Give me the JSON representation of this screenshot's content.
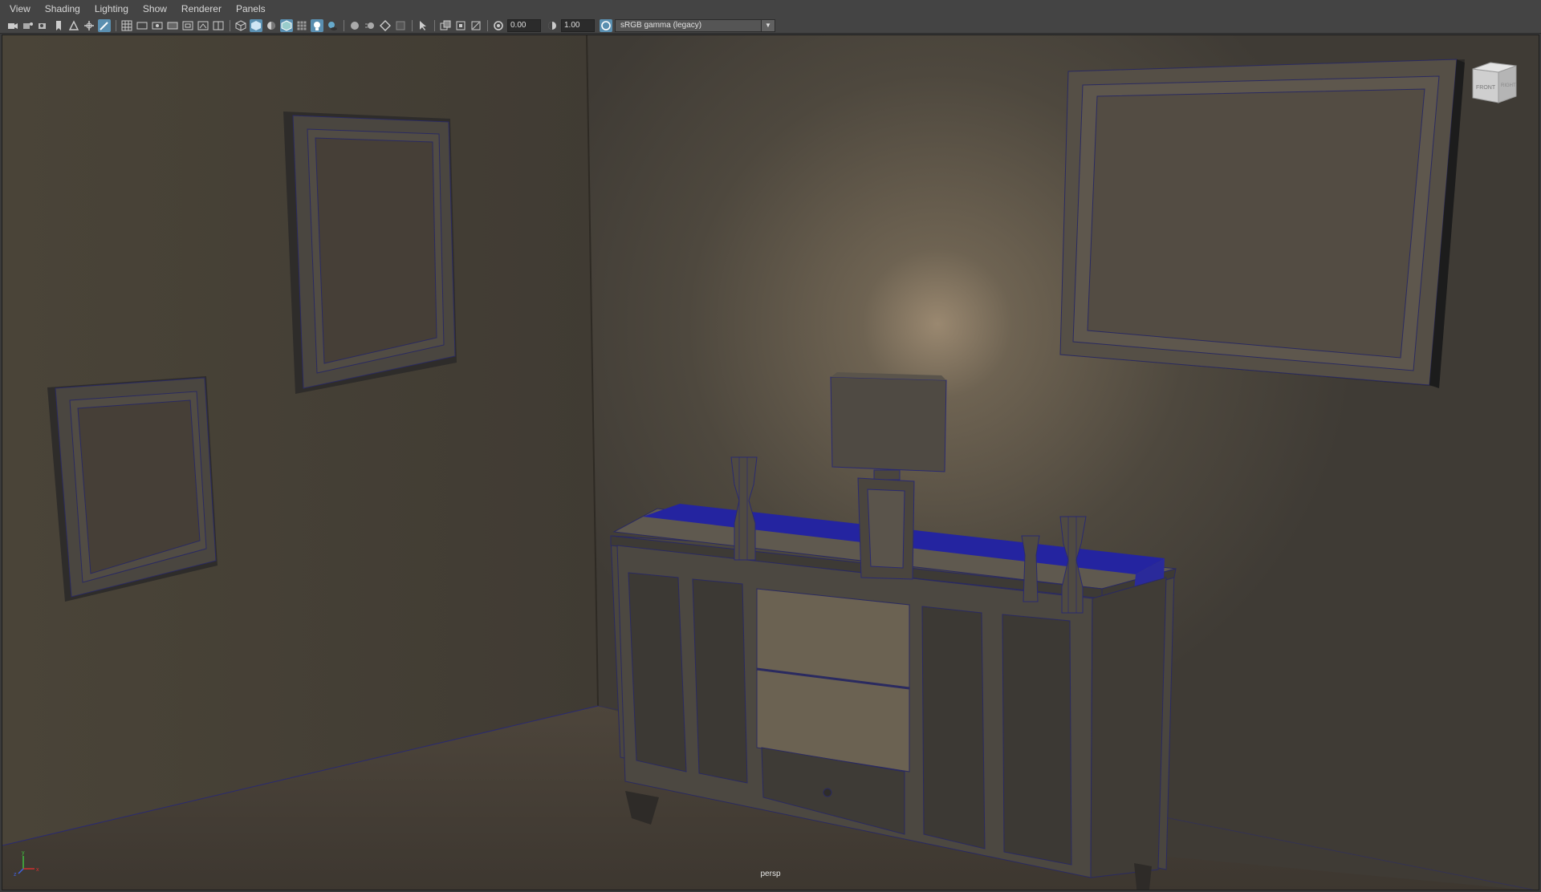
{
  "menu": [
    "View",
    "Shading",
    "Lighting",
    "Show",
    "Renderer",
    "Panels"
  ],
  "toolbar": {
    "exposure": "0.00",
    "gamma": "1.00",
    "color_space": "sRGB gamma (legacy)"
  },
  "viewport": {
    "camera": "persp",
    "viewcube": {
      "front": "FRONT",
      "right": "RIGHT"
    },
    "axis": {
      "x": "x",
      "y": "y",
      "z": "z"
    }
  },
  "colors": {
    "ui_bg": "#444444",
    "active_tool": "#5a8fb0",
    "wire_accent": "#2a2aa8",
    "runner": "#2424a0"
  },
  "icons": [
    "camera-icon",
    "grid-icon",
    "wireframe-icon",
    "smooth-shade-icon",
    "light-icon",
    "isolate-icon",
    "color-space-icon"
  ]
}
